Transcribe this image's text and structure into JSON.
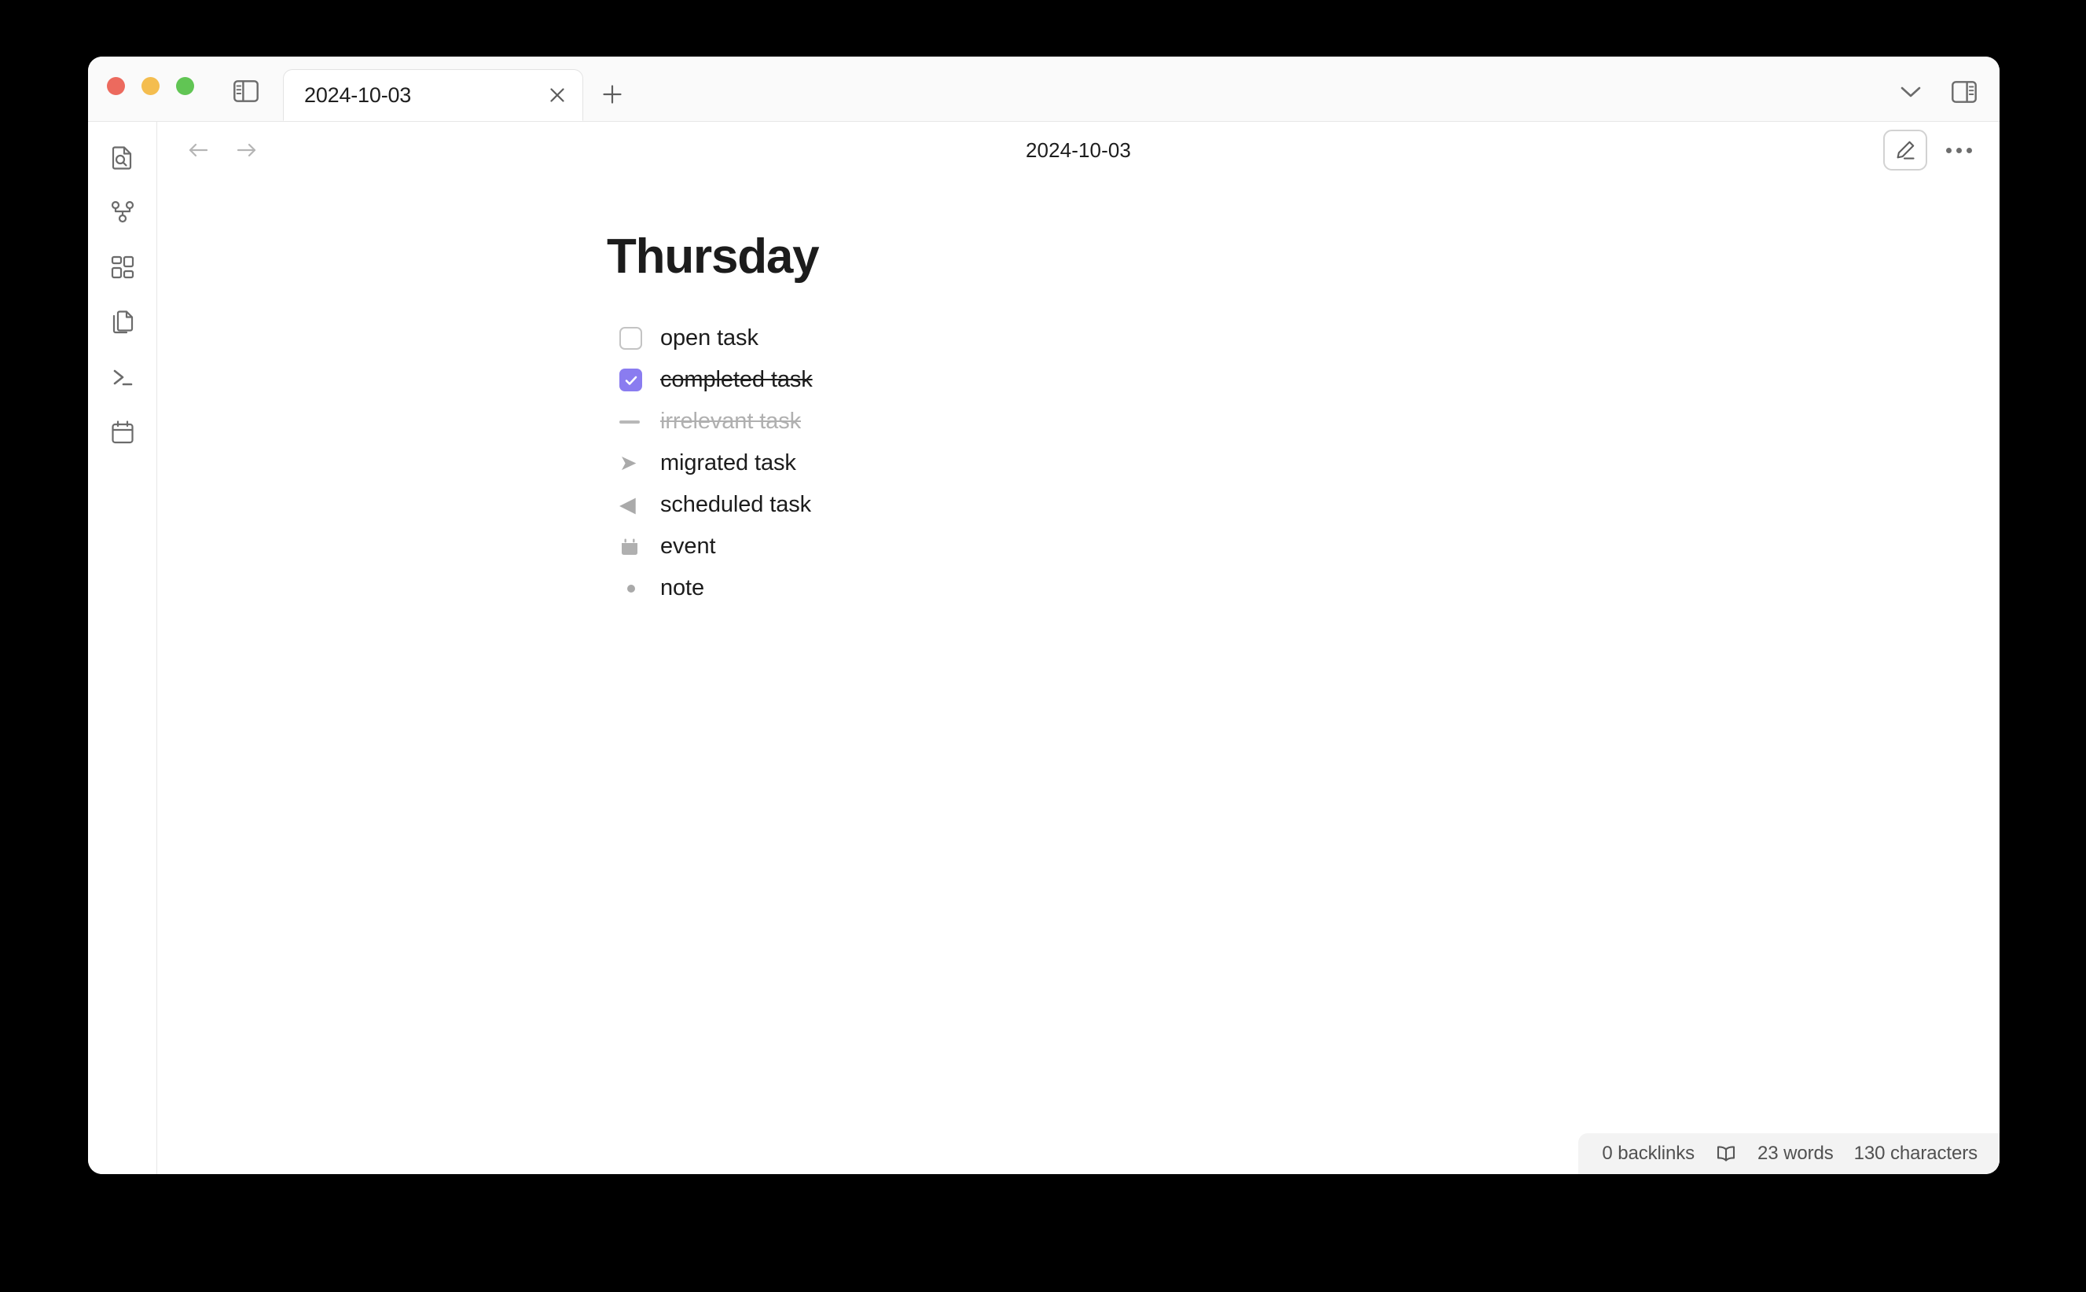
{
  "window": {
    "traffic_lights": [
      "close",
      "minimize",
      "zoom"
    ],
    "colors": {
      "close": "#ec6a5e",
      "minimize": "#f4bd4f",
      "zoom": "#61c554",
      "accent_purple": "#8a7cf0",
      "titlebar_bg": "#fafafa",
      "status_bg": "#f3f3f3"
    }
  },
  "titlebar": {
    "left_sidebar_toggle_icon": "left-sidebar-toggle-icon",
    "tabs": [
      {
        "title": "2024-10-03",
        "active": true,
        "close_icon": "close-icon"
      }
    ],
    "new_tab_icon": "plus-icon",
    "chevron_icon": "chevron-down-icon",
    "right_sidebar_toggle_icon": "right-sidebar-toggle-icon"
  },
  "icon_rail": {
    "items": [
      {
        "name": "sidebar-item-search-document",
        "icon": "document-search-icon"
      },
      {
        "name": "sidebar-item-graph",
        "icon": "graph-node-icon"
      },
      {
        "name": "sidebar-item-blocks",
        "icon": "blocks-grid-icon"
      },
      {
        "name": "sidebar-item-documents",
        "icon": "copy-documents-icon"
      },
      {
        "name": "sidebar-item-terminal",
        "icon": "terminal-icon"
      },
      {
        "name": "sidebar-item-calendar",
        "icon": "calendar-icon"
      }
    ]
  },
  "toolbar": {
    "back_icon": "arrow-left-icon",
    "forward_icon": "arrow-right-icon",
    "document_title": "2024-10-03",
    "edit_icon": "pencil-edit-icon",
    "more_icon": "more-horizontal-icon"
  },
  "note": {
    "heading": "Thursday",
    "tasks": [
      {
        "type": "open",
        "bullet": "checkbox-unchecked-icon",
        "label": "open task",
        "strike": false,
        "muted": false
      },
      {
        "type": "completed",
        "bullet": "checkbox-checked-icon",
        "label": "completed task",
        "strike": true,
        "muted": false
      },
      {
        "type": "irrelevant",
        "bullet": "dash-icon",
        "label": "irrelevant task",
        "strike": true,
        "muted": true
      },
      {
        "type": "migrated",
        "bullet": "arrow-forward-icon",
        "label": "migrated task",
        "strike": false,
        "muted": false
      },
      {
        "type": "scheduled",
        "bullet": "arrow-back-icon",
        "label": "scheduled task",
        "strike": false,
        "muted": false
      },
      {
        "type": "event",
        "bullet": "calendar-filled-icon",
        "label": "event",
        "strike": false,
        "muted": false
      },
      {
        "type": "note",
        "bullet": "bullet-dot-icon",
        "label": "note",
        "strike": false,
        "muted": false
      }
    ]
  },
  "status_bar": {
    "backlinks": "0 backlinks",
    "reading_icon": "open-book-icon",
    "words": "23 words",
    "characters": "130 characters"
  }
}
